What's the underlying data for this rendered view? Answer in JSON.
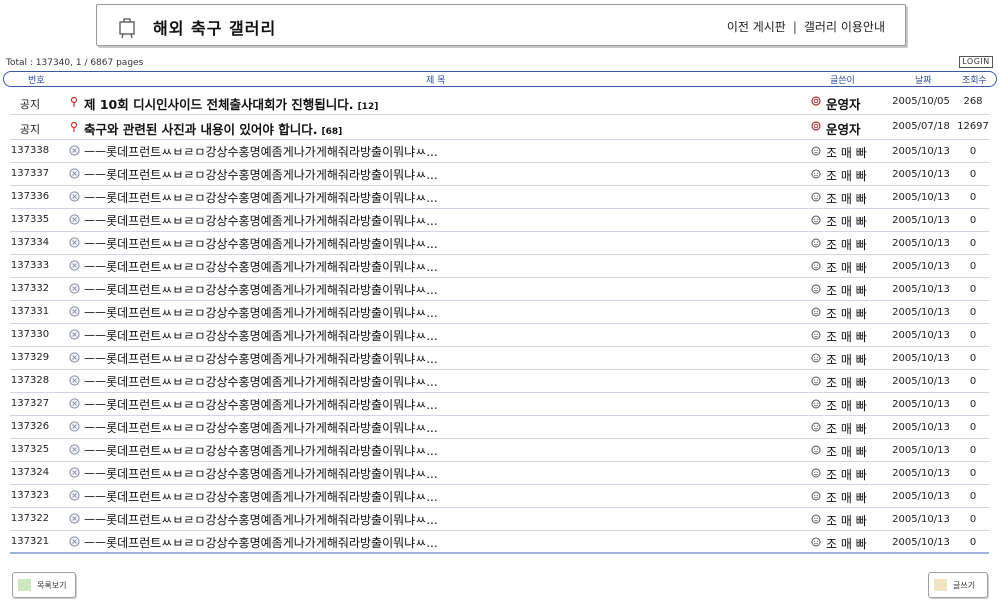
{
  "header": {
    "title": "해외 축구 갤러리",
    "links": {
      "prev_board": "이전 게시판",
      "separator": "|",
      "gallery_guide": "갤러리 이용안내"
    }
  },
  "total_info": "Total : 137340, 1 / 6867 pages",
  "login_label": "LOGIN",
  "columns": {
    "num": "번호",
    "subject": "제 목",
    "author": "글쓴이",
    "date": "날짜",
    "views": "조회수"
  },
  "notices": [
    {
      "num": "공지",
      "subject": "제 10회 디시인사이드 전체출사대회가 진행됩니다.",
      "comment_count": "[12]",
      "author": "운영자",
      "date": "2005/10/05",
      "views": "268"
    },
    {
      "num": "공지",
      "subject": "축구와 관련된 사진과 내용이 있어야 합니다.",
      "comment_count": "[68]",
      "author": "운영자",
      "date": "2005/07/18",
      "views": "12697"
    }
  ],
  "posts": [
    {
      "num": "137338",
      "subject": "ㅡㅡ롯데프런트ㅆㅂㄹㅁ강상수홍명예좀게나가게해줘라방출이뭐냐ㅆ...",
      "author": "조 매 빠",
      "date": "2005/10/13",
      "views": "0"
    },
    {
      "num": "137337",
      "subject": "ㅡㅡ롯데프런트ㅆㅂㄹㅁ강상수홍명예좀게나가게해줘라방출이뭐냐ㅆ...",
      "author": "조 매 빠",
      "date": "2005/10/13",
      "views": "0"
    },
    {
      "num": "137336",
      "subject": "ㅡㅡ롯데프런트ㅆㅂㄹㅁ강상수홍명예좀게나가게해줘라방출이뭐냐ㅆ...",
      "author": "조 매 빠",
      "date": "2005/10/13",
      "views": "0"
    },
    {
      "num": "137335",
      "subject": "ㅡㅡ롯데프런트ㅆㅂㄹㅁ강상수홍명예좀게나가게해줘라방출이뭐냐ㅆ...",
      "author": "조 매 빠",
      "date": "2005/10/13",
      "views": "0"
    },
    {
      "num": "137334",
      "subject": "ㅡㅡ롯데프런트ㅆㅂㄹㅁ강상수홍명예좀게나가게해줘라방출이뭐냐ㅆ...",
      "author": "조 매 빠",
      "date": "2005/10/13",
      "views": "0"
    },
    {
      "num": "137333",
      "subject": "ㅡㅡ롯데프런트ㅆㅂㄹㅁ강상수홍명예좀게나가게해줘라방출이뭐냐ㅆ...",
      "author": "조 매 빠",
      "date": "2005/10/13",
      "views": "0"
    },
    {
      "num": "137332",
      "subject": "ㅡㅡ롯데프런트ㅆㅂㄹㅁ강상수홍명예좀게나가게해줘라방출이뭐냐ㅆ...",
      "author": "조 매 빠",
      "date": "2005/10/13",
      "views": "0"
    },
    {
      "num": "137331",
      "subject": "ㅡㅡ롯데프런트ㅆㅂㄹㅁ강상수홍명예좀게나가게해줘라방출이뭐냐ㅆ...",
      "author": "조 매 빠",
      "date": "2005/10/13",
      "views": "0"
    },
    {
      "num": "137330",
      "subject": "ㅡㅡ롯데프런트ㅆㅂㄹㅁ강상수홍명예좀게나가게해줘라방출이뭐냐ㅆ...",
      "author": "조 매 빠",
      "date": "2005/10/13",
      "views": "0"
    },
    {
      "num": "137329",
      "subject": "ㅡㅡ롯데프런트ㅆㅂㄹㅁ강상수홍명예좀게나가게해줘라방출이뭐냐ㅆ...",
      "author": "조 매 빠",
      "date": "2005/10/13",
      "views": "0"
    },
    {
      "num": "137328",
      "subject": "ㅡㅡ롯데프런트ㅆㅂㄹㅁ강상수홍명예좀게나가게해줘라방출이뭐냐ㅆ...",
      "author": "조 매 빠",
      "date": "2005/10/13",
      "views": "0"
    },
    {
      "num": "137327",
      "subject": "ㅡㅡ롯데프런트ㅆㅂㄹㅁ강상수홍명예좀게나가게해줘라방출이뭐냐ㅆ...",
      "author": "조 매 빠",
      "date": "2005/10/13",
      "views": "0"
    },
    {
      "num": "137326",
      "subject": "ㅡㅡ롯데프런트ㅆㅂㄹㅁ강상수홍명예좀게나가게해줘라방출이뭐냐ㅆ...",
      "author": "조 매 빠",
      "date": "2005/10/13",
      "views": "0"
    },
    {
      "num": "137325",
      "subject": "ㅡㅡ롯데프런트ㅆㅂㄹㅁ강상수홍명예좀게나가게해줘라방출이뭐냐ㅆ...",
      "author": "조 매 빠",
      "date": "2005/10/13",
      "views": "0"
    },
    {
      "num": "137324",
      "subject": "ㅡㅡ롯데프런트ㅆㅂㄹㅁ강상수홍명예좀게나가게해줘라방출이뭐냐ㅆ...",
      "author": "조 매 빠",
      "date": "2005/10/13",
      "views": "0"
    },
    {
      "num": "137323",
      "subject": "ㅡㅡ롯데프런트ㅆㅂㄹㅁ강상수홍명예좀게나가게해줘라방출이뭐냐ㅆ...",
      "author": "조 매 빠",
      "date": "2005/10/13",
      "views": "0"
    },
    {
      "num": "137322",
      "subject": "ㅡㅡ롯데프런트ㅆㅂㄹㅁ강상수홍명예좀게나가게해줘라방출이뭐냐ㅆ...",
      "author": "조 매 빠",
      "date": "2005/10/13",
      "views": "0"
    },
    {
      "num": "137321",
      "subject": "ㅡㅡ롯데프런트ㅆㅂㄹㅁ강상수홍명예좀게나가게해줘라방출이뭐냐ㅆ...",
      "author": "조 매 빠",
      "date": "2005/10/13",
      "views": "0"
    }
  ],
  "footer": {
    "list_label": "목록보기",
    "write_label": "글쓰기"
  },
  "colors": {
    "accent": "#3a5aa8",
    "row_divider": "#d4d4e4",
    "notice_icon": "#cc3333",
    "list_swatch": "#cfe8c2",
    "write_swatch": "#f2e4c2"
  },
  "icons": {
    "header": "gallery-cart-icon",
    "notice": "notice-pin-icon",
    "post": "post-bubble-icon",
    "admin": "admin-emblem-icon",
    "member": "member-smiley-icon"
  }
}
